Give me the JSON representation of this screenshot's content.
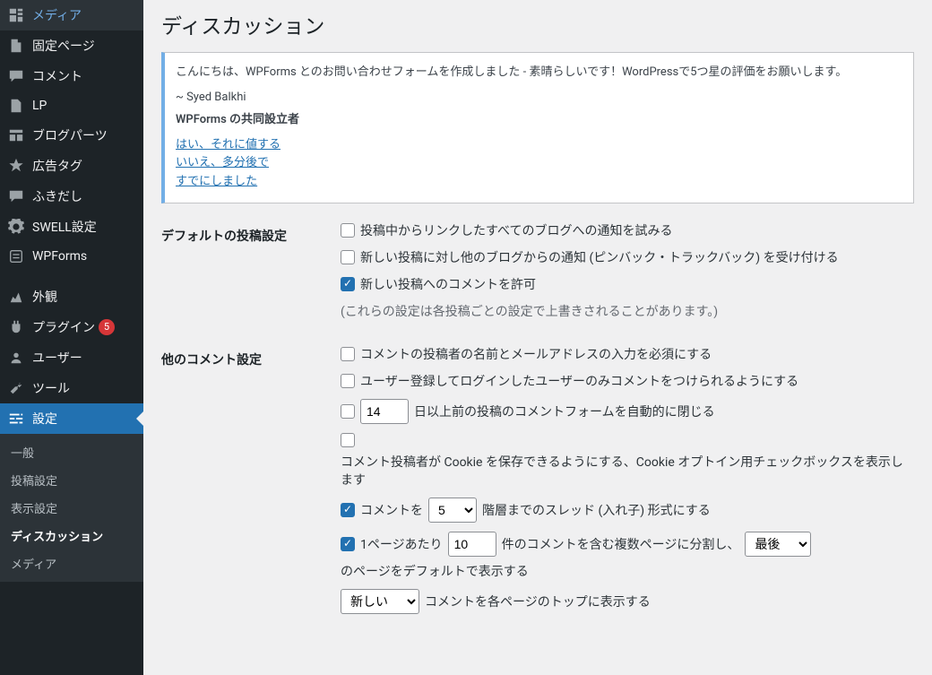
{
  "page": {
    "title": "ディスカッション"
  },
  "sidebar": {
    "items": [
      {
        "icon": "media",
        "label": "メディア"
      },
      {
        "icon": "page",
        "label": "固定ページ"
      },
      {
        "icon": "comment",
        "label": "コメント"
      },
      {
        "icon": "page",
        "label": "LP"
      },
      {
        "icon": "blog-parts",
        "label": "ブログパーツ"
      },
      {
        "icon": "tag",
        "label": "広告タグ"
      },
      {
        "icon": "balloon",
        "label": "ふきだし"
      },
      {
        "icon": "swell",
        "label": "SWELL設定"
      },
      {
        "icon": "wpforms",
        "label": "WPForms"
      },
      {
        "icon": "appearance",
        "label": "外観"
      },
      {
        "icon": "plugin",
        "label": "プラグイン",
        "badge": "5"
      },
      {
        "icon": "users",
        "label": "ユーザー"
      },
      {
        "icon": "tools",
        "label": "ツール"
      },
      {
        "icon": "settings",
        "label": "設定"
      }
    ],
    "submenu": [
      "一般",
      "投稿設定",
      "表示設定",
      "ディスカッション",
      "メディア"
    ]
  },
  "notice": {
    "message": "こんにちは、WPForms とのお問い合わせフォームを作成しました - 素晴らしいです！WordPressで5つ星の評価をお願いします。",
    "from": "~ Syed Balkhi",
    "role": "WPForms の共同設立者",
    "links": [
      "はい、それに値する",
      "いいえ、多分後で",
      "すでにしました"
    ]
  },
  "settings": {
    "defaultPost": {
      "heading": "デフォルトの投稿設定",
      "opt1": "投稿中からリンクしたすべてのブログへの通知を試みる",
      "opt2": "新しい投稿に対し他のブログからの通知 (ピンバック・トラックバック) を受け付ける",
      "opt3": "新しい投稿へのコメントを許可",
      "desc": "(これらの設定は各投稿ごとの設定で上書きされることがあります。)"
    },
    "otherComment": {
      "heading": "他のコメント設定",
      "c1": "コメントの投稿者の名前とメールアドレスの入力を必須にする",
      "c2": "ユーザー登録してログインしたユーザーのみコメントをつけられるようにする",
      "c3_days": "14",
      "c3_prefix": "",
      "c3_suffix": "日以上前の投稿のコメントフォームを自動的に閉じる",
      "c4": "コメント投稿者が Cookie を保存できるようにする、Cookie オプトイン用チェックボックスを表示します",
      "c5_prefix": "コメントを",
      "c5_suffix": "階層までのスレッド (入れ子) 形式にする",
      "c5_levels": "5",
      "c6_prefix": "1ページあたり",
      "c6_perpage": "10",
      "c6_mid": "件のコメントを含む複数ページに分割し、",
      "c6_page": "最後",
      "c6_suffix": "のページをデフォルトで表示する",
      "c7_order": "新しい",
      "c7_suffix": "コメントを各ページのトップに表示する"
    }
  }
}
